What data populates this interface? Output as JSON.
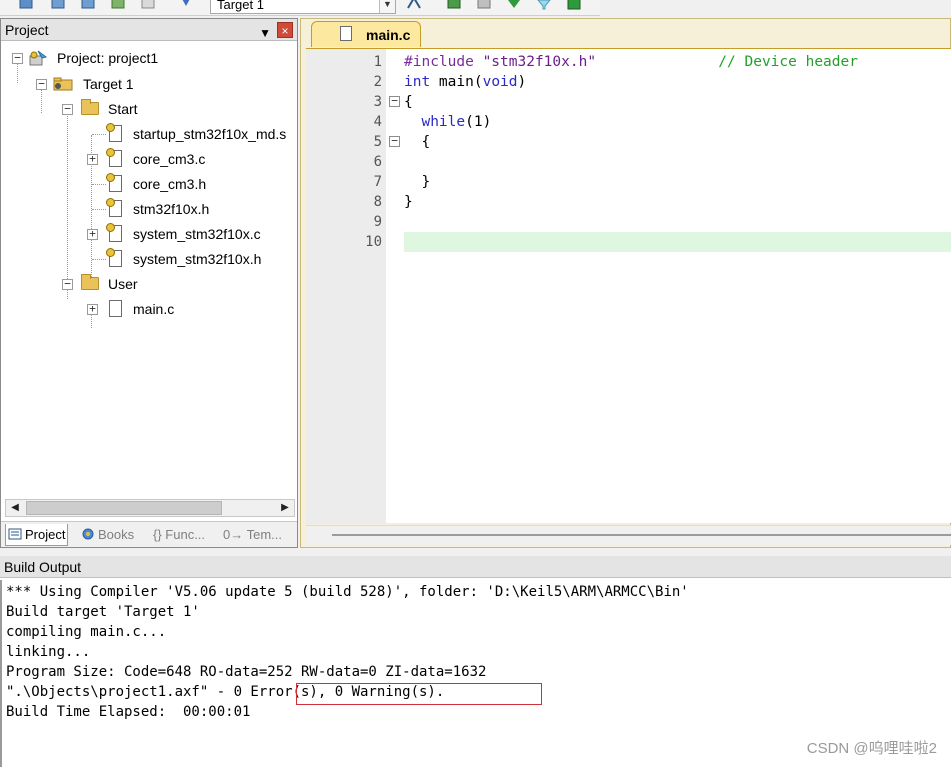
{
  "toolbar": {
    "target_select_value": "Target 1",
    "icons": [
      "batch-build-icon",
      "build-icon",
      "rebuild-icon",
      "download-icon",
      "translate-icon",
      "options-for-target-icon",
      "manage-components-icon",
      "select-packs-icon",
      "pack-installer-icon",
      "debug-icon"
    ]
  },
  "project_panel": {
    "title": "Project",
    "pin_glyph": "p",
    "close_glyph": "×",
    "tree": {
      "project": "Project: project1",
      "target": "Target 1",
      "groups": [
        {
          "name": "Start",
          "files": [
            {
              "name": "startup_stm32f10x_md.s",
              "expandable": false
            },
            {
              "name": "core_cm3.c",
              "expandable": true
            },
            {
              "name": "core_cm3.h",
              "expandable": false
            },
            {
              "name": "stm32f10x.h",
              "expandable": false
            },
            {
              "name": "system_stm32f10x.c",
              "expandable": true
            },
            {
              "name": "system_stm32f10x.h",
              "expandable": false
            }
          ]
        },
        {
          "name": "User",
          "files": [
            {
              "name": "main.c",
              "expandable": true
            }
          ]
        }
      ]
    },
    "tabs": [
      {
        "label": "Project",
        "active": true,
        "icon": "project-tab-icon"
      },
      {
        "label": "Books",
        "active": false,
        "icon": "books-tab-icon"
      },
      {
        "label": "{} Func...",
        "active": false,
        "icon": "functions-tab-icon"
      },
      {
        "label": "0→ Tem...",
        "active": false,
        "icon": "templates-tab-icon"
      }
    ]
  },
  "editor": {
    "tab_label": "main.c",
    "highlight_line": 10,
    "lines": [
      {
        "n": "1",
        "code": [
          [
            "pp",
            "#include "
          ],
          [
            "str",
            "\"stm32f10x.h\""
          ],
          [
            "txt",
            "              "
          ],
          [
            "cmt",
            "// Device header"
          ]
        ]
      },
      {
        "n": "2",
        "code": [
          [
            "kw",
            "int"
          ],
          [
            "txt",
            " main("
          ],
          [
            "kw",
            "void"
          ],
          [
            "txt",
            ")"
          ]
        ]
      },
      {
        "n": "3",
        "fold": "−",
        "code": [
          [
            "txt",
            "{"
          ]
        ]
      },
      {
        "n": "4",
        "code": [
          [
            "txt",
            "  "
          ],
          [
            "kw",
            "while"
          ],
          [
            "txt",
            "(1)"
          ]
        ]
      },
      {
        "n": "5",
        "fold": "−",
        "code": [
          [
            "txt",
            "  {"
          ]
        ]
      },
      {
        "n": "6",
        "code": []
      },
      {
        "n": "7",
        "code": [
          [
            "txt",
            "  }"
          ]
        ]
      },
      {
        "n": "8",
        "code": [
          [
            "txt",
            "}"
          ]
        ]
      },
      {
        "n": "9",
        "code": []
      },
      {
        "n": "10",
        "code": []
      }
    ]
  },
  "build_output": {
    "title": "Build Output",
    "lines": [
      "*** Using Compiler 'V5.06 update 5 (build 528)', folder: 'D:\\Keil5\\ARM\\ARMCC\\Bin'",
      "Build target 'Target 1'",
      "compiling main.c...",
      "linking...",
      "Program Size: Code=648 RO-data=252 RW-data=0 ZI-data=1632",
      "\".\\Objects\\project1.axf\" - 0 Error(s), 0 Warning(s).",
      "Build Time Elapsed:  00:00:01"
    ],
    "highlight_box_color": "#d0303a"
  },
  "watermark": "CSDN @呜哩哇啦2"
}
